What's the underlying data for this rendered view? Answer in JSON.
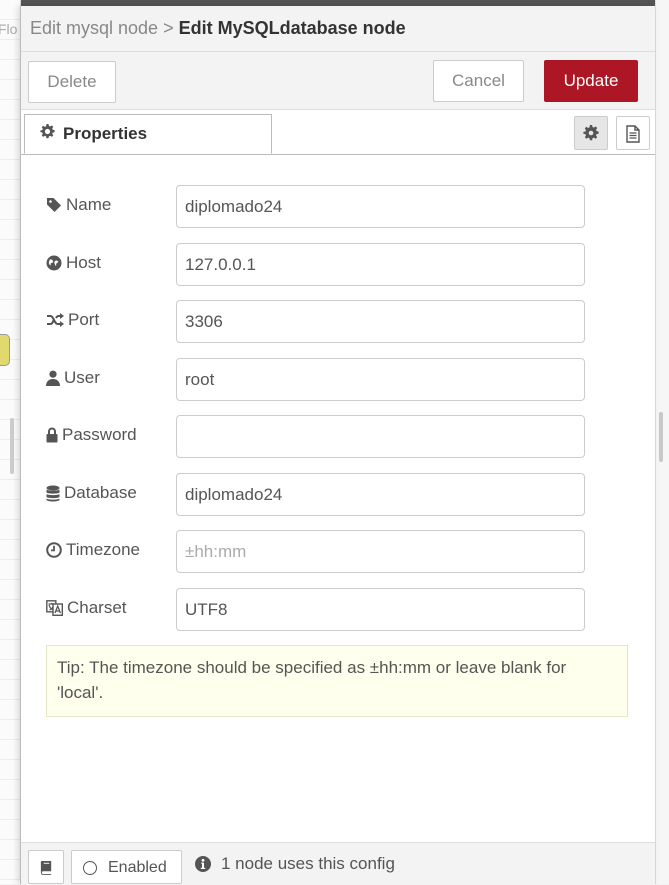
{
  "background": {
    "tab_text": "Flo"
  },
  "header": {
    "breadcrumb": "Edit mysql node",
    "separator": ">",
    "title": "Edit MySQLdatabase node"
  },
  "toolbar": {
    "delete_label": "Delete",
    "cancel_label": "Cancel",
    "update_label": "Update",
    "update_color": "#ad1625"
  },
  "tabs": {
    "properties_label": "Properties",
    "icons": [
      "gear-icon",
      "document-icon"
    ]
  },
  "form": {
    "name": {
      "label": "Name",
      "value": "diplomado24"
    },
    "host": {
      "label": "Host",
      "value": "127.0.0.1"
    },
    "port": {
      "label": "Port",
      "value": "3306"
    },
    "user": {
      "label": "User",
      "value": "root"
    },
    "password": {
      "label": "Password",
      "value": ""
    },
    "database": {
      "label": "Database",
      "value": "diplomado24"
    },
    "timezone": {
      "label": "Timezone",
      "value": "",
      "placeholder": "±hh:mm"
    },
    "charset": {
      "label": "Charset",
      "value": "UTF8"
    }
  },
  "tip": {
    "line1": "Tip: The timezone should be specified as ±hh:mm or leave blank for",
    "line2": "'local'."
  },
  "footer": {
    "enabled_label": "Enabled",
    "usage_text": "1 node uses this config"
  }
}
